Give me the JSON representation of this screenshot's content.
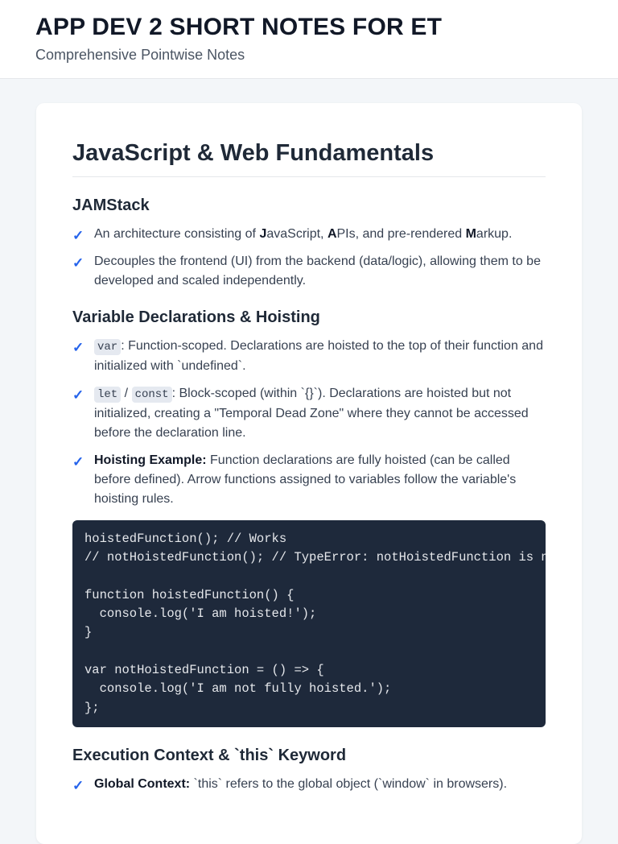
{
  "header": {
    "title": "APP DEV 2 SHORT NOTES FOR ET",
    "subtitle": "Comprehensive Pointwise Notes"
  },
  "section": {
    "title": "JavaScript & Web Fundamentals",
    "jam": {
      "title": "JAMStack",
      "i1": [
        "An architecture consisting of ",
        "J",
        "avaScript, ",
        "A",
        "PIs, and pre-rendered ",
        "M",
        "arkup."
      ],
      "i2": "Decouples the frontend (UI) from the backend (data/logic), allowing them to be developed and scaled independently."
    },
    "vars": {
      "title": "Variable Declarations & Hoisting",
      "var_code": "var",
      "var_text": ": Function-scoped. Declarations are hoisted to the top of their function and initialized with `undefined`.",
      "let_code": "let",
      "slash": " / ",
      "const_code": "const",
      "let_text": ": Block-scoped (within `{}`). Declarations are hoisted but not initialized, creating a \"Temporal Dead Zone\" where they cannot be accessed before the declaration line.",
      "hoist_label": "Hoisting Example:",
      "hoist_text": " Function declarations are fully hoisted (can be called before defined). Arrow functions assigned to variables follow the variable's hoisting rules."
    },
    "code": "hoistedFunction(); // Works\n// notHoistedFunction(); // TypeError: notHoistedFunction is not a function\n\nfunction hoistedFunction() {\n  console.log('I am hoisted!');\n}\n\nvar notHoistedFunction = () => {\n  console.log('I am not fully hoisted.');\n};",
    "exec": {
      "title": "Execution Context & `this` Keyword",
      "global_label": "Global Context:",
      "global_text": " `this` refers to the global object (`window` in browsers)."
    }
  },
  "icons": {
    "check": "✓"
  }
}
